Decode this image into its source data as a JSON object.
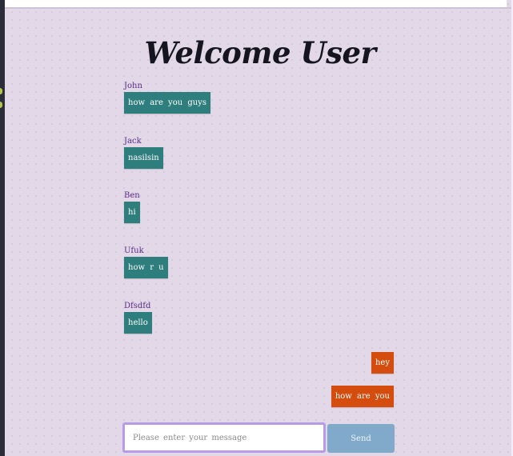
{
  "page": {
    "title": "Welcome User"
  },
  "messages": [
    {
      "sender": "John",
      "text": "how are you guys",
      "own": false
    },
    {
      "sender": "Jack",
      "text": "nasilsin",
      "own": false
    },
    {
      "sender": "Ben",
      "text": "hi",
      "own": false
    },
    {
      "sender": "Ufuk",
      "text": "how r u",
      "own": false
    },
    {
      "sender": "Dfsdfd",
      "text": "hello",
      "own": false
    },
    {
      "sender": "",
      "text": "hey",
      "own": true
    },
    {
      "sender": "",
      "text": "how are you",
      "own": true
    }
  ],
  "composer": {
    "placeholder": "Please enter your message",
    "value": "",
    "send_label": "Send"
  },
  "colors": {
    "background": "#e2d8e8",
    "incoming_bubble": "#2e7e7d",
    "outgoing_bubble": "#d44d0f",
    "sender_name": "#5a2a84",
    "send_button": "#81a9c9",
    "input_focus_border": "#b79be9"
  }
}
